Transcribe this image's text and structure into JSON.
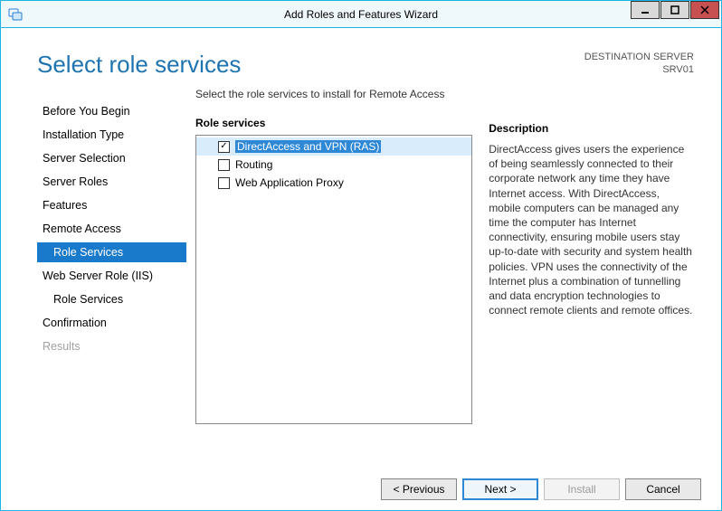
{
  "window": {
    "title": "Add Roles and Features Wizard"
  },
  "header": {
    "page_title": "Select role services",
    "destination_label": "DESTINATION SERVER",
    "destination_value": "SRV01"
  },
  "nav": {
    "items": [
      {
        "label": "Before You Begin",
        "level": 0
      },
      {
        "label": "Installation Type",
        "level": 0
      },
      {
        "label": "Server Selection",
        "level": 0
      },
      {
        "label": "Server Roles",
        "level": 0
      },
      {
        "label": "Features",
        "level": 0
      },
      {
        "label": "Remote Access",
        "level": 0
      },
      {
        "label": "Role Services",
        "level": 1,
        "selected": true
      },
      {
        "label": "Web Server Role (IIS)",
        "level": 0
      },
      {
        "label": "Role Services",
        "level": 1
      },
      {
        "label": "Confirmation",
        "level": 0
      },
      {
        "label": "Results",
        "level": 0,
        "disabled": true
      }
    ]
  },
  "main": {
    "instruction": "Select the role services to install for Remote Access",
    "group_label": "Role services",
    "items": [
      {
        "label": "DirectAccess and VPN (RAS)",
        "checked": true,
        "selected": true
      },
      {
        "label": "Routing",
        "checked": false
      },
      {
        "label": "Web Application Proxy",
        "checked": false
      }
    ],
    "description_title": "Description",
    "description_text": "DirectAccess gives users the experience of being seamlessly connected to their corporate network any time they have Internet access. With DirectAccess, mobile computers can be managed any time the computer has Internet connectivity, ensuring mobile users stay up-to-date with security and system health policies. VPN uses the connectivity of the Internet plus a combination of tunnelling and data encryption technologies to connect remote clients and remote offices."
  },
  "footer": {
    "previous": "< Previous",
    "next": "Next >",
    "install": "Install",
    "cancel": "Cancel"
  }
}
